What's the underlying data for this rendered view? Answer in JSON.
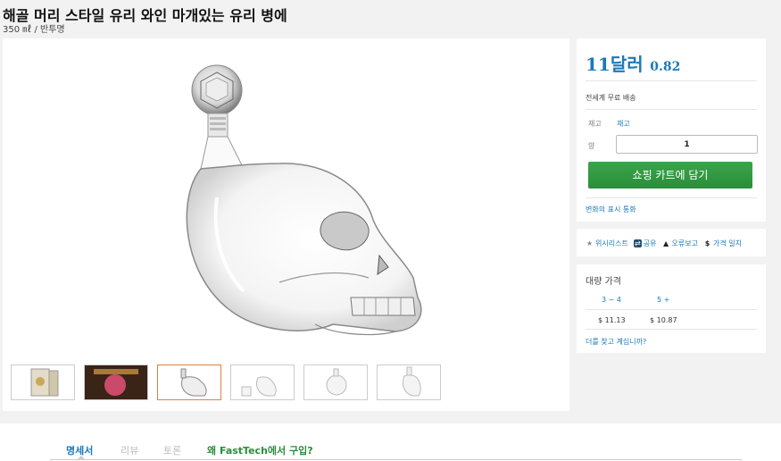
{
  "product": {
    "title": "해골 머리 스타일 유리 와인 마개있는 유리 병에",
    "subtitle": "350 ㎖ / 반투명"
  },
  "price": {
    "main": "11달러",
    "cents": "0.82",
    "accent_color": "#1a7ab8"
  },
  "shipping": {
    "text": "전세계 무료 배송"
  },
  "stock": {
    "label": "재고",
    "value": "재고"
  },
  "quantity": {
    "label": "양",
    "value": "1"
  },
  "cart": {
    "label": "쇼핑 카트에 담기",
    "color": "#2b8d3a"
  },
  "currency": {
    "label": "변화의 표시 통화"
  },
  "actions": [
    {
      "icon": "star-icon",
      "label": "위시리스트"
    },
    {
      "icon": "share-icon",
      "label": "공유"
    },
    {
      "icon": "warning-icon",
      "label": "오류보고"
    },
    {
      "icon": "dollar-icon",
      "label": "가격 일치"
    }
  ],
  "bulk": {
    "title": "대량 가격",
    "tiers": [
      {
        "qty": "3 ~ 4",
        "price": "$ 11.13"
      },
      {
        "qty": "5 +",
        "price": "$ 10.87"
      }
    ],
    "more_link": "더를 찾고 계십니까?"
  },
  "gallery": {
    "thumbnails": [
      "box",
      "red-wine",
      "skull-selected",
      "skull-2",
      "skull-3",
      "skull-4"
    ],
    "selected_index": 2
  },
  "tabs": [
    {
      "label": "명세서",
      "state": "active"
    },
    {
      "label": "리뷰",
      "state": "inactive"
    },
    {
      "label": "토론",
      "state": "inactive"
    },
    {
      "label": "왜 FastTech에서 구입?",
      "state": "promo"
    }
  ]
}
